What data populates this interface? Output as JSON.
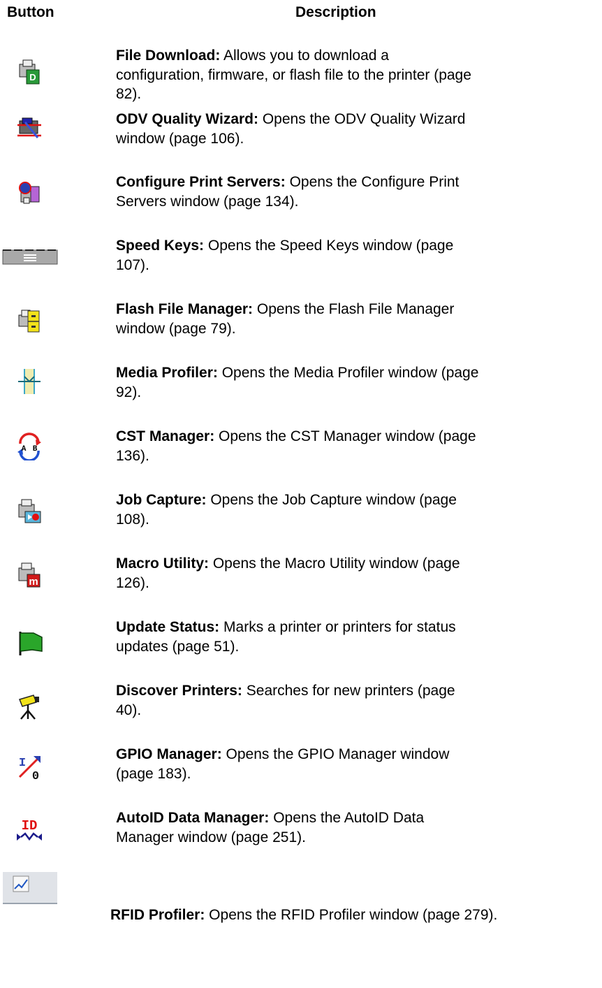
{
  "header": {
    "button": "Button",
    "description": "Description"
  },
  "rows": [
    {
      "icon": "file-download-icon",
      "title": "File Download:",
      "line1": " Allows you to download a",
      "line2": "configuration, firmware, or flash file to the printer (page",
      "line3": "82)."
    },
    {
      "icon": "odv-quality-wizard-icon",
      "title": "ODV Quality Wizard:",
      "line1": " Opens the ODV Quality Wizard",
      "line2": "window (page 106).",
      "line3": ""
    },
    {
      "icon": "configure-print-servers-icon",
      "title": "Configure Print Servers:",
      "line1": " Opens the Configure Print",
      "line2": "Servers window (page 134).",
      "line3": ""
    },
    {
      "icon": "speed-keys-icon",
      "title": "Speed Keys:",
      "line1": " Opens the Speed Keys window (page",
      "line2": "107).",
      "line3": ""
    },
    {
      "icon": "flash-file-manager-icon",
      "title": "Flash File Manager:",
      "line1": " Opens the Flash File Manager",
      "line2": "window (page 79).",
      "line3": ""
    },
    {
      "icon": "media-profiler-icon",
      "title": "Media Profiler:",
      "line1": " Opens the Media Profiler window (page",
      "line2": "92).",
      "line3": ""
    },
    {
      "icon": "cst-manager-icon",
      "title": "CST Manager:",
      "line1": " Opens the CST Manager window (page",
      "line2": "136).",
      "line3": ""
    },
    {
      "icon": "job-capture-icon",
      "title": "Job Capture:",
      "line1": " Opens the Job Capture window (page",
      "line2": "108).",
      "line3": ""
    },
    {
      "icon": "macro-utility-icon",
      "title": "Macro Utility:",
      "line1": " Opens the Macro Utility window (page",
      "line2": "126).",
      "line3": ""
    },
    {
      "icon": "update-status-icon",
      "title": "Update Status:",
      "line1": " Marks a printer or printers for status",
      "line2": "updates (page 51).",
      "line3": ""
    },
    {
      "icon": "discover-printers-icon",
      "title": "Discover Printers:",
      "line1": " Searches for new printers (page",
      "line2": "40).",
      "line3": ""
    },
    {
      "icon": "gpio-manager-icon",
      "title": "GPIO Manager:",
      "line1": " Opens the GPIO Manager window",
      "line2": "(page 183).",
      "line3": ""
    },
    {
      "icon": "autoid-data-manager-icon",
      "title": "AutoID Data Manager:",
      "line1": " Opens the AutoID Data",
      "line2": "Manager window (page 251).",
      "line3": ""
    },
    {
      "icon": "rfid-profiler-icon",
      "title": "RFID Profiler:",
      "line1": " Opens the RFID Profiler window (page 279).",
      "line2": "",
      "line3": ""
    }
  ],
  "icon_texts": {
    "cst_a": "A",
    "cst_b": "B",
    "gpio_i": "I",
    "gpio_o": "0",
    "autoid_id": "ID",
    "file_download_d": "D",
    "macro_m": "m"
  }
}
